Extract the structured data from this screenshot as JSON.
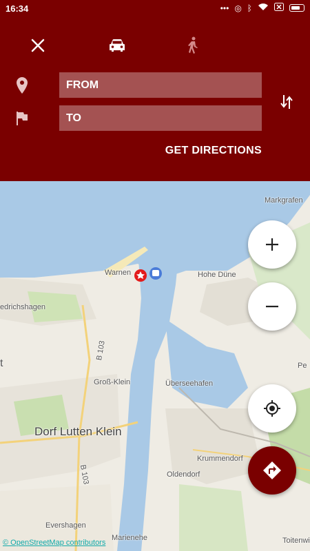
{
  "status_bar": {
    "time": "16:34",
    "icons": [
      "more-icon",
      "alarm-icon",
      "bluetooth-icon",
      "wifi-icon",
      "sim-icon",
      "battery-icon"
    ]
  },
  "header": {
    "close_icon": "close-icon",
    "modes": [
      "car-icon",
      "walk-icon"
    ],
    "from": {
      "placeholder": "FROM",
      "value": "",
      "icon": "location-pin-icon"
    },
    "to": {
      "placeholder": "TO",
      "value": "",
      "icon": "flag-icon"
    },
    "swap_icon": "swap-vertical-icon",
    "get_directions_label": "GET DIRECTIONS"
  },
  "map": {
    "labels": {
      "markgrafen": "Markgrafen",
      "warnen": "Warnen",
      "hohe_dune": "Hohe Düne",
      "edrichshagen": "edrichshagen",
      "b103_top": "B 103",
      "gross_klein": "Groß-Klein",
      "ueberseehafen": "Überseehafen",
      "pe": "Pe",
      "dorf_lutten_klein": "Dorf Lutten Klein",
      "krummendorf": "Krummendorf",
      "oldendorf": "Oldendorf",
      "b103_bottom": "B 103",
      "evershagen": "Evershagen",
      "marienehe": "Marienehe",
      "toitenwi": "Toitenwi",
      "left_t": "t"
    },
    "attribution": "© OpenStreetMap contributors",
    "zoom_in_label": "+",
    "zoom_out_label": "−"
  },
  "colors": {
    "header": "#7a0000",
    "water": "#a9c9e6",
    "land": "#f2efe9",
    "green": "#b9d89a"
  }
}
